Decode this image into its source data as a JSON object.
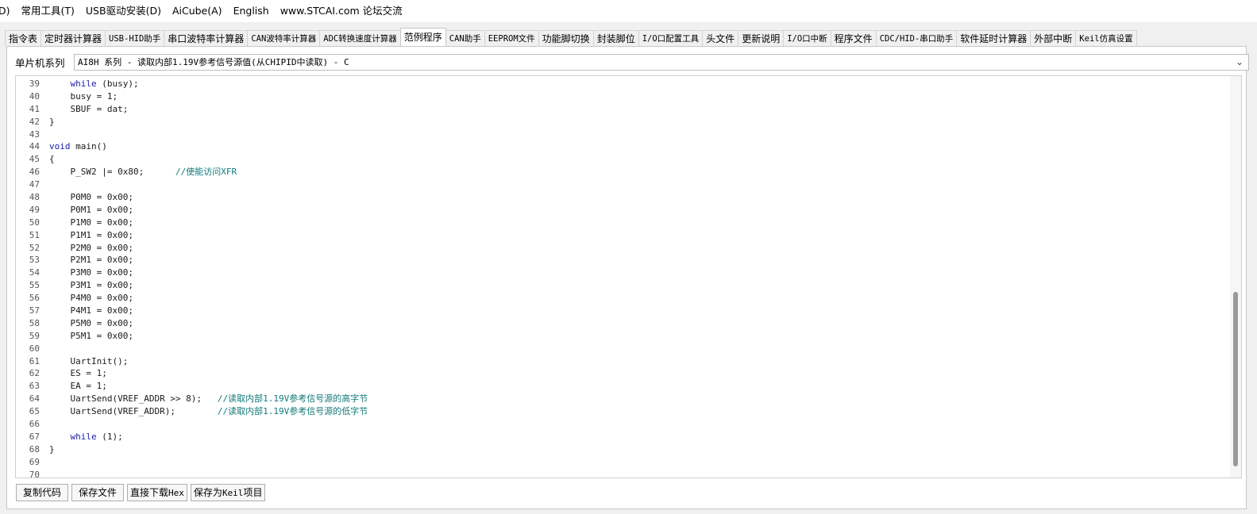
{
  "menubar": {
    "items": [
      "D)",
      "常用工具(T)",
      "USB驱动安装(D)",
      "AiCube(A)",
      "English",
      "www.STCAI.com 论坛交流"
    ]
  },
  "tabs": [
    {
      "label": "指令表",
      "mono": false
    },
    {
      "label": "定时器计算器",
      "mono": false
    },
    {
      "label": "USB-HID助手",
      "mono": true
    },
    {
      "label": "串口波特率计算器",
      "mono": false
    },
    {
      "label": "CAN波特率计算器",
      "mono": true
    },
    {
      "label": "ADC转换速度计算器",
      "mono": true
    },
    {
      "label": "范例程序",
      "mono": false,
      "active": true
    },
    {
      "label": "CAN助手",
      "mono": true
    },
    {
      "label": "EEPROM文件",
      "mono": true
    },
    {
      "label": "功能脚切换",
      "mono": false
    },
    {
      "label": "封装脚位",
      "mono": false
    },
    {
      "label": "I/O口配置工具",
      "mono": true
    },
    {
      "label": "头文件",
      "mono": false
    },
    {
      "label": "更新说明",
      "mono": false
    },
    {
      "label": "I/O口中断",
      "mono": true
    },
    {
      "label": "程序文件",
      "mono": false
    },
    {
      "label": "CDC/HID-串口助手",
      "mono": true
    },
    {
      "label": "软件延时计算器",
      "mono": false
    },
    {
      "label": "外部中断",
      "mono": false
    },
    {
      "label": "Keil仿真设置",
      "mono": true
    }
  ],
  "series": {
    "label": "单片机系列",
    "selected": "AI8H 系列 - 读取内部1.19V参考信号源值(从CHIPID中读取) - C"
  },
  "code": [
    {
      "n": "39",
      "parts": [
        [
          "    ",
          ""
        ],
        [
          "while",
          "kw"
        ],
        [
          " (busy);",
          ""
        ]
      ]
    },
    {
      "n": "40",
      "parts": [
        [
          "    busy = 1;",
          ""
        ]
      ]
    },
    {
      "n": "41",
      "parts": [
        [
          "    SBUF = dat;",
          ""
        ]
      ]
    },
    {
      "n": "42",
      "parts": [
        [
          "}",
          ""
        ]
      ]
    },
    {
      "n": "43",
      "parts": []
    },
    {
      "n": "44",
      "parts": [
        [
          "void",
          "kw"
        ],
        [
          " main()",
          ""
        ]
      ]
    },
    {
      "n": "45",
      "parts": [
        [
          "{",
          ""
        ]
      ]
    },
    {
      "n": "46",
      "parts": [
        [
          "    P_SW2 |= 0x80;      ",
          ""
        ],
        [
          "//使能访问XFR",
          "cm"
        ]
      ]
    },
    {
      "n": "47",
      "parts": []
    },
    {
      "n": "48",
      "parts": [
        [
          "    P0M0 = 0x00;",
          ""
        ]
      ]
    },
    {
      "n": "49",
      "parts": [
        [
          "    P0M1 = 0x00;",
          ""
        ]
      ]
    },
    {
      "n": "50",
      "parts": [
        [
          "    P1M0 = 0x00;",
          ""
        ]
      ]
    },
    {
      "n": "51",
      "parts": [
        [
          "    P1M1 = 0x00;",
          ""
        ]
      ]
    },
    {
      "n": "52",
      "parts": [
        [
          "    P2M0 = 0x00;",
          ""
        ]
      ]
    },
    {
      "n": "53",
      "parts": [
        [
          "    P2M1 = 0x00;",
          ""
        ]
      ]
    },
    {
      "n": "54",
      "parts": [
        [
          "    P3M0 = 0x00;",
          ""
        ]
      ]
    },
    {
      "n": "55",
      "parts": [
        [
          "    P3M1 = 0x00;",
          ""
        ]
      ]
    },
    {
      "n": "56",
      "parts": [
        [
          "    P4M0 = 0x00;",
          ""
        ]
      ]
    },
    {
      "n": "57",
      "parts": [
        [
          "    P4M1 = 0x00;",
          ""
        ]
      ]
    },
    {
      "n": "58",
      "parts": [
        [
          "    P5M0 = 0x00;",
          ""
        ]
      ]
    },
    {
      "n": "59",
      "parts": [
        [
          "    P5M1 = 0x00;",
          ""
        ]
      ]
    },
    {
      "n": "60",
      "parts": []
    },
    {
      "n": "61",
      "parts": [
        [
          "    UartInit();",
          ""
        ]
      ]
    },
    {
      "n": "62",
      "parts": [
        [
          "    ES = 1;",
          ""
        ]
      ]
    },
    {
      "n": "63",
      "parts": [
        [
          "    EA = 1;",
          ""
        ]
      ]
    },
    {
      "n": "64",
      "parts": [
        [
          "    UartSend(VREF_ADDR >> 8);   ",
          ""
        ],
        [
          "//读取内部1.19V参考信号源的高字节",
          "cm"
        ]
      ]
    },
    {
      "n": "65",
      "parts": [
        [
          "    UartSend(VREF_ADDR);        ",
          ""
        ],
        [
          "//读取内部1.19V参考信号源的低字节",
          "cm"
        ]
      ]
    },
    {
      "n": "66",
      "parts": []
    },
    {
      "n": "67",
      "parts": [
        [
          "    ",
          ""
        ],
        [
          "while",
          "kw"
        ],
        [
          " (1);",
          ""
        ]
      ]
    },
    {
      "n": "68",
      "parts": [
        [
          "}",
          ""
        ]
      ]
    },
    {
      "n": "69",
      "parts": []
    },
    {
      "n": "70",
      "parts": []
    }
  ],
  "buttons": {
    "copy": "复制代码",
    "save": "保存文件",
    "download_prefix": "直接下载",
    "download_suffix": "Hex",
    "keil_prefix": "保存为",
    "keil_mid": "Keil",
    "keil_suffix": "项目"
  },
  "icons": {
    "dropdown": "chevron-down-icon"
  }
}
